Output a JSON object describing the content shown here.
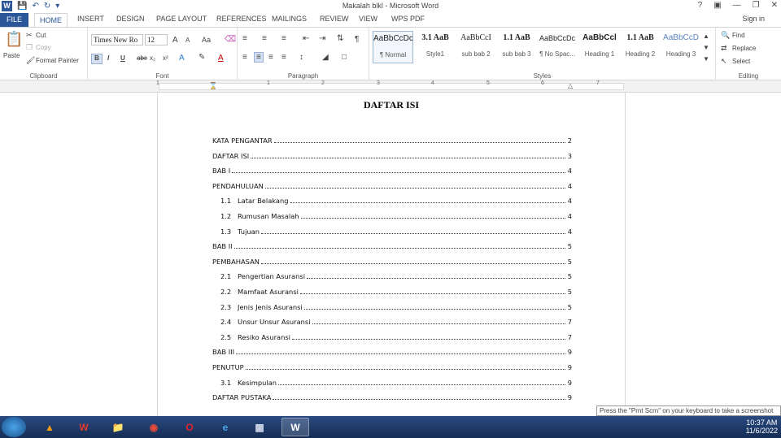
{
  "window": {
    "title": "Makalah blkl - Microsoft Word",
    "help": "?",
    "signin": "Sign in"
  },
  "tabs": [
    "FILE",
    "HOME",
    "INSERT",
    "DESIGN",
    "PAGE LAYOUT",
    "REFERENCES",
    "MAILINGS",
    "REVIEW",
    "VIEW",
    "WPS PDF"
  ],
  "ribbon": {
    "clipboard": {
      "label": "Clipboard",
      "paste": "Paste",
      "cut": "Cut",
      "copy": "Copy",
      "format_painter": "Format Painter"
    },
    "font": {
      "label": "Font",
      "font_name": "Times New Ro",
      "font_size": "12",
      "grow": "A",
      "shrink": "A",
      "case": "Aa",
      "bold": "B",
      "italic": "I",
      "underline": "U",
      "strike": "abc",
      "subscript": "x₂",
      "superscript": "x²"
    },
    "paragraph": {
      "label": "Paragraph",
      "pilcrow": "¶"
    },
    "styles": {
      "label": "Styles",
      "items": [
        {
          "sample": "AaBbCcDc",
          "name": "¶ Normal"
        },
        {
          "sample": "3.1  AaB",
          "name": "Style1"
        },
        {
          "sample": "AaBbCcI",
          "name": "sub bab 2"
        },
        {
          "sample": "1.1  AaB",
          "name": "sub bab 3"
        },
        {
          "sample": "AaBbCcDc",
          "name": "¶ No Spac..."
        },
        {
          "sample": "AaBbCcl",
          "name": "Heading 1"
        },
        {
          "sample": "1.1  AaB",
          "name": "Heading 2"
        },
        {
          "sample": "AaBbCcD",
          "name": "Heading 3"
        }
      ]
    },
    "editing": {
      "label": "Editing",
      "find": "Find",
      "replace": "Replace",
      "select": "Select"
    }
  },
  "ruler": {
    "numbers": [
      "1",
      "1",
      "2",
      "3",
      "4",
      "5",
      "6",
      "7"
    ]
  },
  "document": {
    "title": "DAFTAR ISI",
    "toc": [
      {
        "num": "",
        "text": "KATA PENGANTAR",
        "page": "2"
      },
      {
        "num": "",
        "text": "DAFTAR ISI",
        "page": "3"
      },
      {
        "num": "",
        "text": "BAB I",
        "page": "4"
      },
      {
        "num": "",
        "text": "PENDAHULUAN",
        "page": "4"
      },
      {
        "num": "1.1",
        "text": "Latar Belakang",
        "page": "4"
      },
      {
        "num": "1.2",
        "text": "Rumusan Masalah",
        "page": "4"
      },
      {
        "num": "1.3",
        "text": "Tujuan",
        "page": "4"
      },
      {
        "num": "",
        "text": "BAB II",
        "page": "5"
      },
      {
        "num": "",
        "text": "PEMBAHASAN",
        "page": "5"
      },
      {
        "num": "2.1",
        "text": "Pengertian Asuransi",
        "page": "5"
      },
      {
        "num": "2.2",
        "text": "Mamfaat Asuransi",
        "page": "5"
      },
      {
        "num": "2.3",
        "text": "Jenis Jenis Asuransi",
        "page": "5"
      },
      {
        "num": "2.4",
        "text": "Unsur Unsur Asuransi",
        "page": "7"
      },
      {
        "num": "2.5",
        "text": "Resiko Asuransi",
        "page": "7"
      },
      {
        "num": "",
        "text": "BAB III",
        "page": "9"
      },
      {
        "num": "",
        "text": "PENUTUP",
        "page": "9"
      },
      {
        "num": "3.1",
        "text": "Kesimpulan",
        "page": "9"
      },
      {
        "num": "",
        "text": "DAFTAR PUSTAKA",
        "page": "9"
      }
    ]
  },
  "tooltip": "Press the \"Prnt Scrn\" on your keyboard to take a screenshot",
  "taskbar": {
    "time": "10:37 AM",
    "date": "11/6/2022"
  },
  "colors": {
    "accent": "#2b579a",
    "taskbar": "#1c3a6b"
  }
}
